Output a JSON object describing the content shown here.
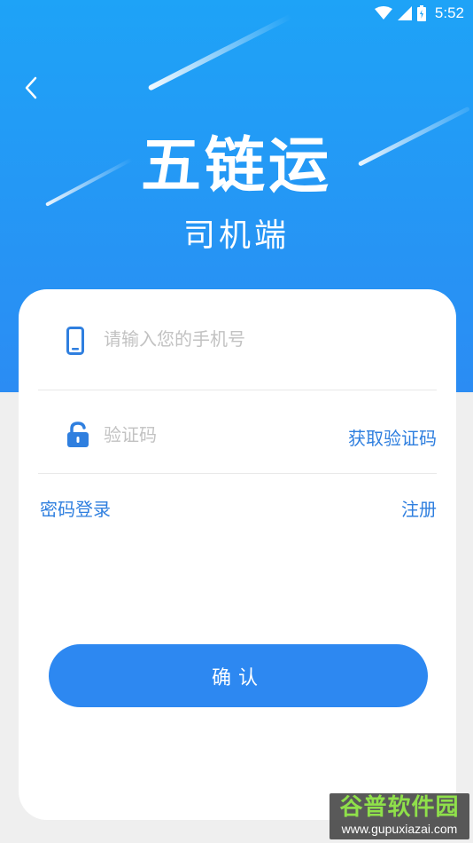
{
  "status_bar": {
    "time": "5:52"
  },
  "header": {
    "brand": "五链运",
    "subtitle": "司机端"
  },
  "form": {
    "phone_placeholder": "请输入您的手机号",
    "code_placeholder": "验证码",
    "get_code_label": "获取验证码",
    "password_login_label": "密码登录",
    "register_label": "注册",
    "confirm_label": "确认"
  },
  "watermark": {
    "title": "谷普软件园",
    "url": "www.gupuxiazai.com"
  },
  "colors": {
    "primary": "#2d88f1",
    "link": "#2f7fdf",
    "hero_top": "#1ea3f7"
  },
  "icons": {
    "back": "chevron-left-icon",
    "phone": "phone-icon",
    "lock": "lock-icon"
  }
}
